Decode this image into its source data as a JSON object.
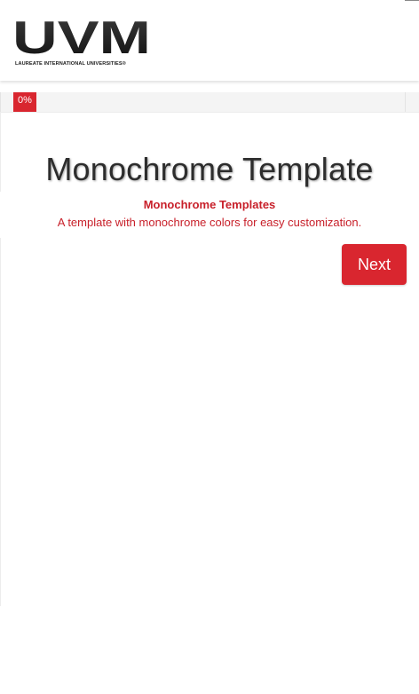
{
  "header": {
    "logo_text": "UVM",
    "logo_subtext": "LAUREATE INTERNATIONAL UNIVERSITIES",
    "logo_trademark": "®"
  },
  "progress": {
    "label": "0%",
    "value": 0
  },
  "content": {
    "title": "Monochrome Template",
    "subtitle": "Monochrome Templates",
    "description": "A template with monochrome colors for easy customization."
  },
  "actions": {
    "next_label": "Next"
  },
  "colors": {
    "accent": "#d9262f",
    "title_text": "#2d2d2d",
    "logo_dark": "#1a1a1a"
  }
}
